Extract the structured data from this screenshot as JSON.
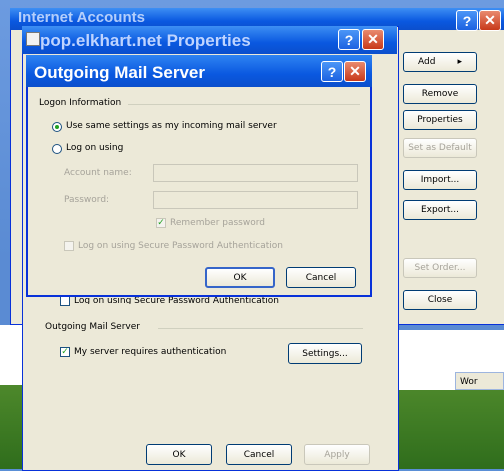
{
  "desktop": {
    "taskbar_item": "Wor"
  },
  "back_window": {
    "title": "Internet Accounts",
    "buttons": {
      "add": "Add",
      "remove": "Remove",
      "properties": "Properties",
      "set_default": "Set as Default",
      "import": "Import...",
      "export": "Export...",
      "set_order": "Set Order...",
      "close": "Close"
    }
  },
  "props_window": {
    "title": "pop.elkhart.net Properties",
    "hidden_option": "Log on using Secure Password Authentication",
    "outgoing_group": "Outgoing Mail Server",
    "requires_auth": "My server requires authentication",
    "settings_button": "Settings...",
    "ok": "OK",
    "cancel": "Cancel",
    "apply": "Apply"
  },
  "dialog": {
    "title": "Outgoing Mail Server",
    "logon_group": "Logon Information",
    "radio_same": "Use same settings as my incoming mail server",
    "radio_logon": "Log on using",
    "account_name_label": "Account name:",
    "password_label": "Password:",
    "remember_password": "Remember password",
    "spa": "Log on using Secure Password Authentication",
    "ok": "OK",
    "cancel": "Cancel"
  },
  "titlebar": {
    "help": "?",
    "close": "✕"
  }
}
